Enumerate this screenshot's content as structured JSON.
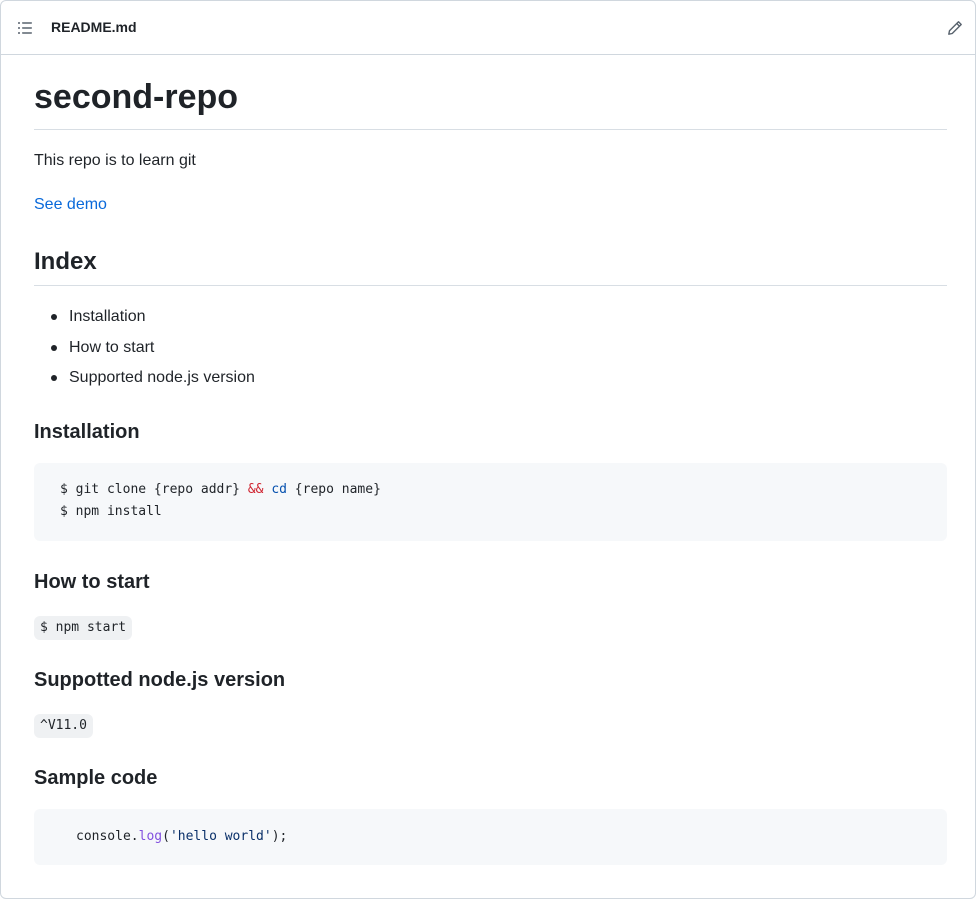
{
  "header": {
    "toc_icon": "list-unordered-icon",
    "file_name": "README.md",
    "edit_icon": "pencil-icon"
  },
  "readme": {
    "title": "second-repo",
    "description": "This repo is to learn git",
    "demo_link": "See demo",
    "index_heading": "Index",
    "index_items": [
      "Installation",
      "How to start",
      "Supported node.js version"
    ],
    "installation": {
      "heading": "Installation",
      "line1_prefix": "$ git clone {repo addr} ",
      "line1_and": "&&",
      "line1_cd": "cd",
      "line1_suffix": " {repo name}",
      "line2": "$ npm install"
    },
    "how_to_start": {
      "heading": "How to start",
      "code": "$ npm start"
    },
    "node_version": {
      "heading": "Suppotted node.js version",
      "code": "^V11.0"
    },
    "sample_code": {
      "heading": "Sample code",
      "obj": "console.",
      "method": "log",
      "open": "(",
      "string": "'hello world'",
      "close": ");"
    }
  },
  "colors": {
    "link": "#0969da",
    "keyword_red": "#cf222e",
    "keyword_blue": "#0550ae",
    "method_purple": "#8250df",
    "code_bg": "#f6f8fa"
  }
}
